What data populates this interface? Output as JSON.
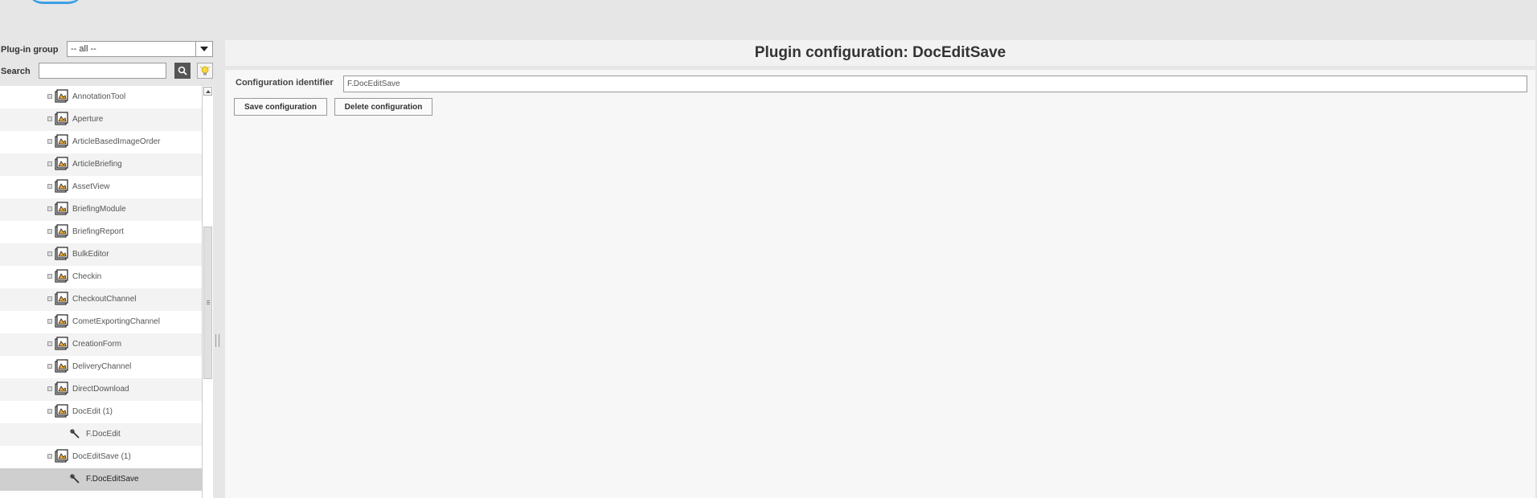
{
  "filter": {
    "plugin_group_label": "Plug-in group",
    "plugin_group_value": "-- all --",
    "search_label": "Search",
    "search_value": ""
  },
  "tree": {
    "items": [
      {
        "label": "AnnotationTool",
        "type": "group"
      },
      {
        "label": "Aperture",
        "type": "group"
      },
      {
        "label": "ArticleBasedImageOrder",
        "type": "group"
      },
      {
        "label": "ArticleBriefing",
        "type": "group"
      },
      {
        "label": "AssetView",
        "type": "group"
      },
      {
        "label": "BriefingModule",
        "type": "group"
      },
      {
        "label": "BriefingReport",
        "type": "group"
      },
      {
        "label": "BulkEditor",
        "type": "group"
      },
      {
        "label": "Checkin",
        "type": "group"
      },
      {
        "label": "CheckoutChannel",
        "type": "group"
      },
      {
        "label": "CometExportingChannel",
        "type": "group"
      },
      {
        "label": "CreationForm",
        "type": "group"
      },
      {
        "label": "DeliveryChannel",
        "type": "group"
      },
      {
        "label": "DirectDownload",
        "type": "group"
      },
      {
        "label": "DocEdit (1)",
        "type": "group"
      },
      {
        "label": "F.DocEdit",
        "type": "config"
      },
      {
        "label": "DocEditSave (1)",
        "type": "group"
      },
      {
        "label": "F.DocEditSave",
        "type": "config",
        "selected": true
      }
    ]
  },
  "main": {
    "title": "Plugin configuration: DocEditSave",
    "config_identifier_label": "Configuration identifier",
    "config_identifier_value": "F.DocEditSave",
    "save_button": "Save configuration",
    "delete_button": "Delete configuration"
  },
  "colors": {
    "background": "#e6e6e6",
    "selected_row": "#cfcfcf",
    "folder_icon_accent": "#f0a830",
    "logo_accent": "#3aa0e6"
  },
  "icons": {
    "search": "search-icon",
    "hint": "lightbulb-icon",
    "group": "plugin-folder-icon",
    "config": "wrench-icon"
  }
}
